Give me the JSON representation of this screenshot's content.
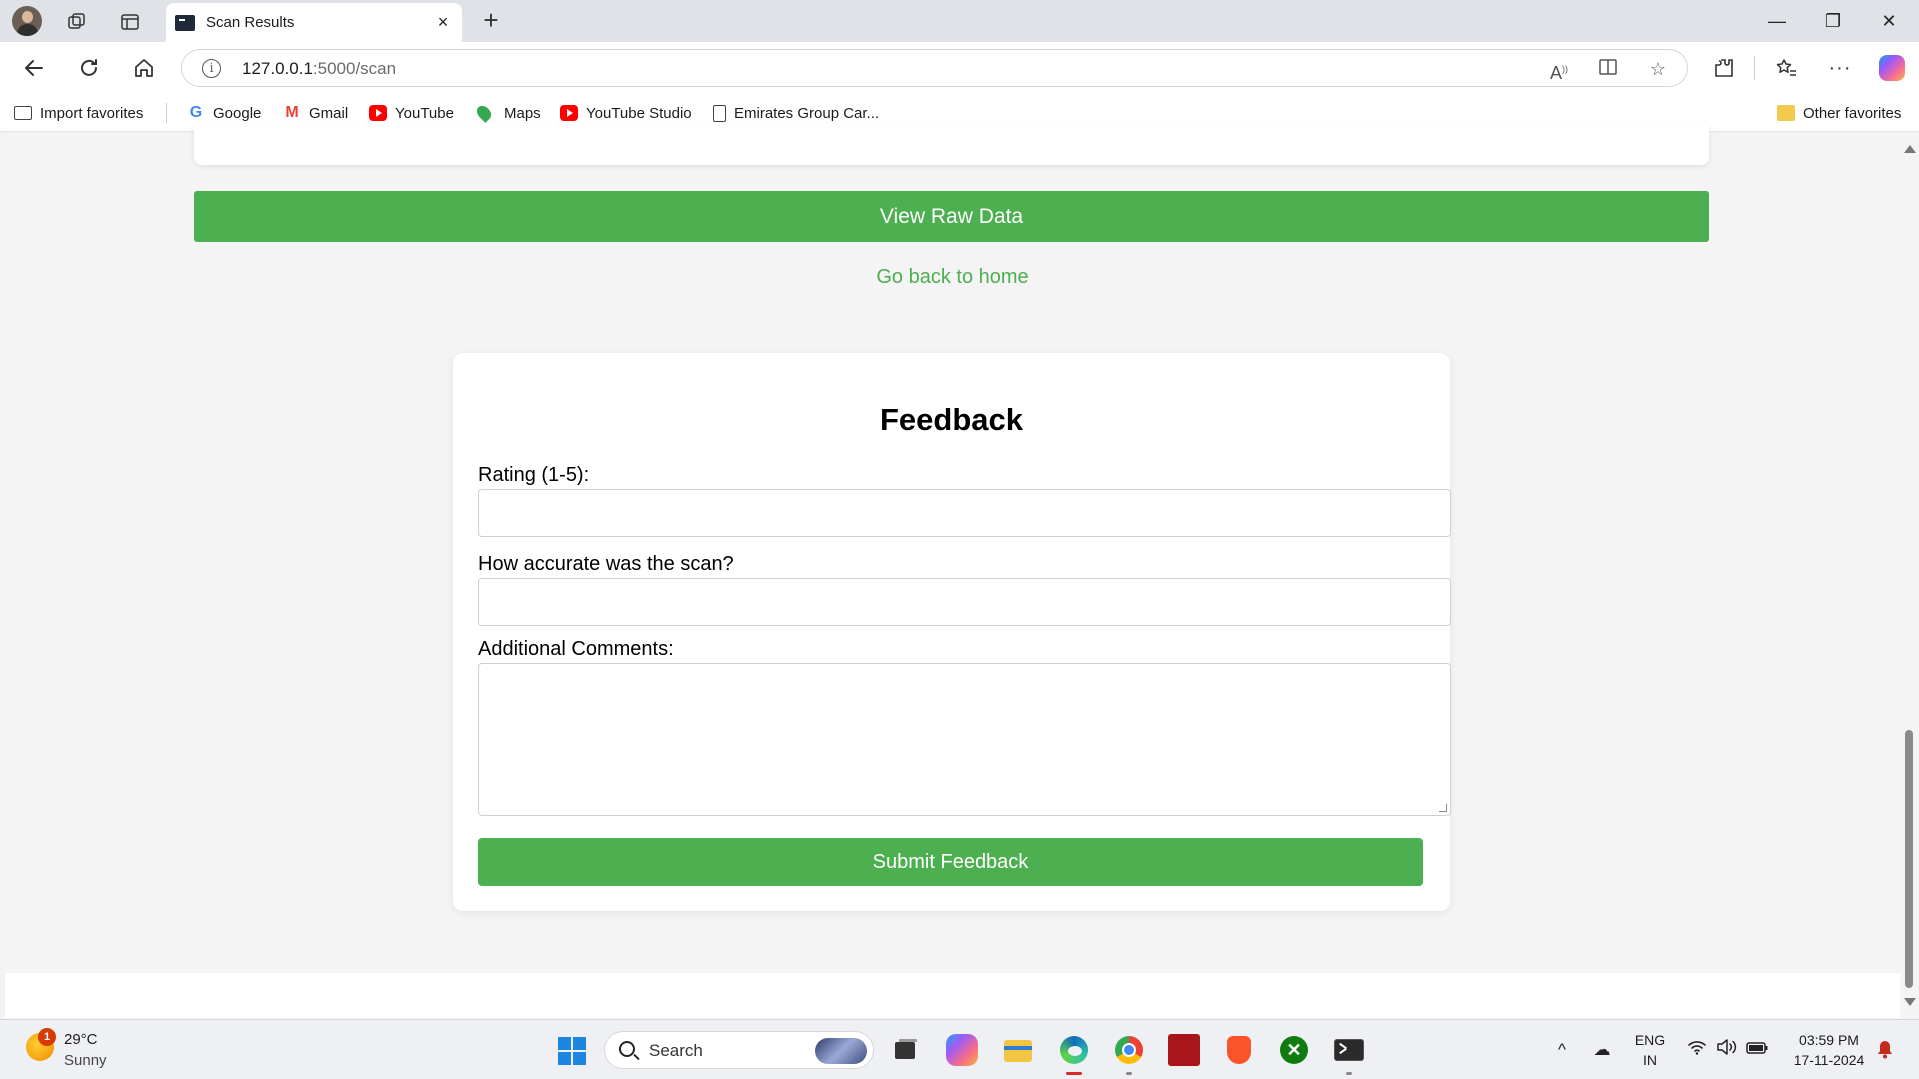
{
  "browser": {
    "tab": {
      "title": "Scan Results",
      "close_glyph": "×"
    },
    "new_tab_glyph": "+",
    "window_controls": {
      "minimize": "—",
      "restore": "❐",
      "close": "✕"
    },
    "url_host": "127.0.0.1",
    "url_path": ":5000/scan",
    "toolbar_icons": [
      "back-icon",
      "refresh-icon",
      "home-icon",
      "read-aloud-icon",
      "immersive-reader-icon",
      "favorite-star-icon",
      "extensions-icon",
      "favorites-icon",
      "more-icon",
      "copilot-icon"
    ],
    "favorites": {
      "import": "Import favorites",
      "items": [
        "Google",
        "Gmail",
        "YouTube",
        "Maps",
        "YouTube Studio",
        "Emirates Group Car..."
      ],
      "other": "Other favorites"
    }
  },
  "page": {
    "raw_button": "View Raw Data",
    "home_link": "Go back to home",
    "feedback": {
      "title": "Feedback",
      "rating_label": "Rating (1-5):",
      "rating_value": "",
      "accuracy_label": "How accurate was the scan?",
      "accuracy_value": "",
      "comments_label": "Additional Comments:",
      "comments_value": "",
      "submit": "Submit Feedback"
    },
    "accent_color": "#4caf50"
  },
  "taskbar": {
    "weather": {
      "badge": "1",
      "temp": "29°C",
      "condition": "Sunny"
    },
    "search_placeholder": "Search",
    "apps": [
      "task-view-icon",
      "copilot-app-icon",
      "file-explorer-icon",
      "edge-icon",
      "chrome-icon",
      "app-icon",
      "brave-icon",
      "xbox-icon",
      "terminal-icon"
    ],
    "tray": {
      "lang_top": "ENG",
      "lang_bottom": "IN",
      "time": "03:59 PM",
      "date": "17-11-2024"
    }
  }
}
